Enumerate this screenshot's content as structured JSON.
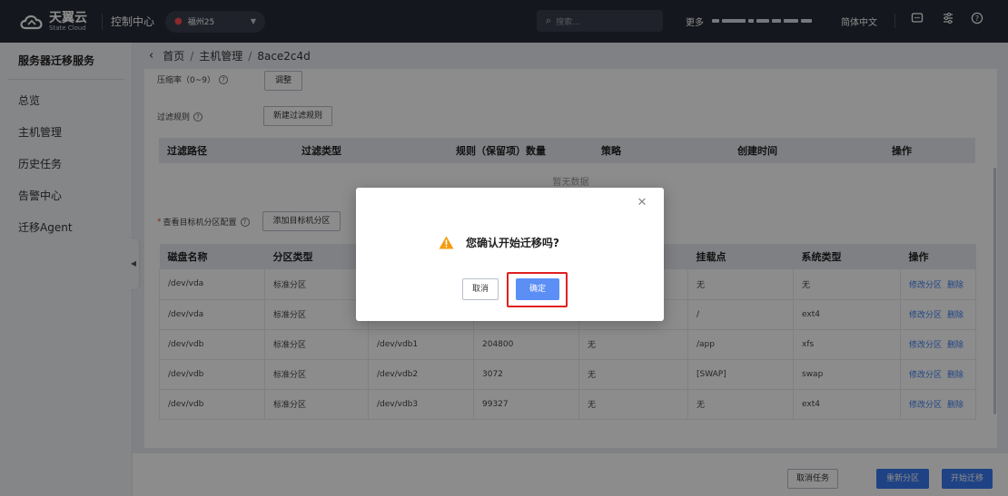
{
  "topbar": {
    "logo_cn": "天翼云",
    "logo_en": "State Cloud",
    "console": "控制中心",
    "region": "福州25",
    "search_placeholder": "搜索...",
    "more": "更多",
    "language": "简体中文"
  },
  "sidebar": {
    "title": "服务器迁移服务",
    "items": [
      {
        "label": "总览"
      },
      {
        "label": "主机管理"
      },
      {
        "label": "历史任务"
      },
      {
        "label": "告警中心"
      },
      {
        "label": "迁移Agent"
      }
    ]
  },
  "breadcrumb": {
    "home": "首页",
    "section": "主机管理",
    "current": "8ace2c4d"
  },
  "form": {
    "compression_label": "压缩率（0~9）",
    "adjust_button": "调整",
    "filter_rule_label": "过滤规则",
    "new_filter_button": "新建过滤规则",
    "partition_label": "查看目标机分区配置",
    "add_partition_button": "添加目标机分区"
  },
  "filter_table": {
    "columns": [
      "过滤路径",
      "过滤类型",
      "规则（保留项）数量",
      "策略",
      "创建时间",
      "操作"
    ],
    "empty_text": "暂无数据"
  },
  "partition_table": {
    "columns": [
      "磁盘名称",
      "分区类型",
      "",
      "",
      "",
      "挂载点",
      "系统类型",
      "操作"
    ],
    "rows": [
      [
        "/dev/vda",
        "标准分区",
        "",
        "",
        "",
        "无",
        "无"
      ],
      [
        "/dev/vda",
        "标准分区",
        "",
        "",
        "",
        "/",
        "ext4"
      ],
      [
        "/dev/vdb",
        "标准分区",
        "/dev/vdb1",
        "204800",
        "无",
        "/app",
        "xfs"
      ],
      [
        "/dev/vdb",
        "标准分区",
        "/dev/vdb2",
        "3072",
        "无",
        "[SWAP]",
        "swap"
      ],
      [
        "/dev/vdb",
        "标准分区",
        "/dev/vdb3",
        "99327",
        "无",
        "无",
        "ext4"
      ]
    ],
    "edit_link": "修改分区",
    "delete_link": "删除"
  },
  "footer": {
    "cancel_task": "取消任务",
    "repartition": "重新分区",
    "start_migration": "开始迁移"
  },
  "dialog": {
    "message": "您确认开始迁移吗?",
    "cancel": "取消",
    "confirm": "确定",
    "close_icon": "close-icon",
    "warning_icon": "warning-icon"
  },
  "colors": {
    "topbar_bg": "#262a35",
    "primary": "#3a78f0",
    "link": "#3b7ef2",
    "warning": "#f39c12",
    "highlight_frame": "#e02020"
  }
}
